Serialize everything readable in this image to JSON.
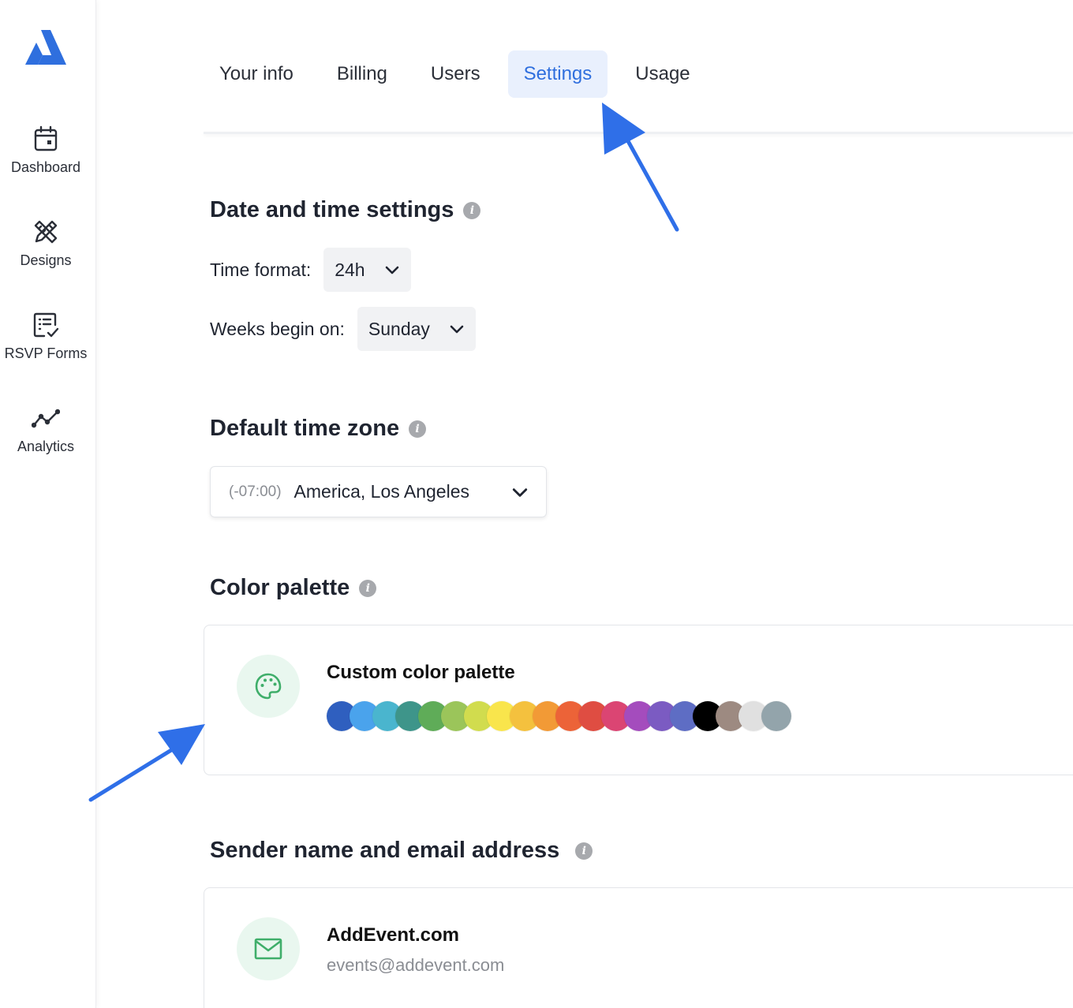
{
  "brand": {
    "accent": "#2f6fde",
    "logo_color": "#2f6fde"
  },
  "sidebar": {
    "items": [
      {
        "label": "Dashboard",
        "icon": "calendar-icon"
      },
      {
        "label": "Designs",
        "icon": "design-tools-icon"
      },
      {
        "label": "RSVP Forms",
        "icon": "form-check-icon"
      },
      {
        "label": "Analytics",
        "icon": "analytics-line-icon"
      }
    ]
  },
  "tabs": [
    {
      "label": "Your info",
      "active": false
    },
    {
      "label": "Billing",
      "active": false
    },
    {
      "label": "Users",
      "active": false
    },
    {
      "label": "Settings",
      "active": true
    },
    {
      "label": "Usage",
      "active": false
    }
  ],
  "date_time": {
    "title": "Date and time settings",
    "time_format_label": "Time format:",
    "time_format_value": "24h",
    "week_start_label": "Weeks begin on:",
    "week_start_value": "Sunday"
  },
  "timezone": {
    "title": "Default time zone",
    "offset": "(-07:00)",
    "name": "America, Los Angeles"
  },
  "color_palette": {
    "title": "Color palette",
    "card_title": "Custom color palette",
    "colors": [
      "#2f5fbf",
      "#4aa3ec",
      "#4ab5ce",
      "#3e958a",
      "#5fac58",
      "#9bc55a",
      "#d1dc4e",
      "#f9e54c",
      "#f4c13e",
      "#f29a36",
      "#ec6338",
      "#df4d42",
      "#db4573",
      "#a44cbd",
      "#7b5bc2",
      "#5e6dc4",
      "#000000",
      "#9d8a81",
      "#e0e0e0",
      "#93a4ab"
    ]
  },
  "sender": {
    "title": "Sender name and email address",
    "name": "AddEvent.com",
    "email": "events@addevent.com"
  },
  "annotations": {
    "arrow_color": "#2f6fe8"
  }
}
